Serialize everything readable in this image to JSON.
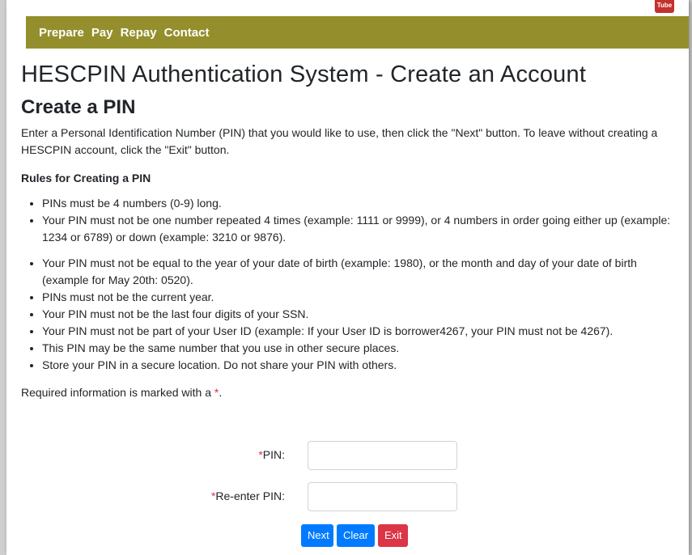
{
  "header": {
    "youtube_label": "Tube"
  },
  "nav": {
    "items": [
      "Prepare",
      "Pay",
      "Repay",
      "Contact"
    ]
  },
  "page": {
    "title": "HESCPIN Authentication System - Create an Account",
    "subtitle": "Create a PIN",
    "intro": "Enter a Personal Identification Number (PIN) that you would like to use, then click the \"Next\" button. To leave without creating a HESCPIN account, click the \"Exit\" button.",
    "rules_heading": "Rules for Creating a PIN",
    "rules": [
      "PINs must be 4 numbers (0-9) long.",
      "Your PIN must not be one number repeated 4 times (example: 1111 or 9999), or 4 numbers in order going either up (example: 1234 or 6789) or down (example: 3210 or 9876).",
      "Your PIN must not be equal to the year of your date of birth (example: 1980), or the month and day of your date of birth (example for May 20th: 0520).",
      "PINs must not be the current year.",
      "Your PIN must not be the last four digits of your SSN.",
      "Your PIN must not be part of your User ID (example: If your User ID is borrower4267, your PIN must not be 4267).",
      "This PIN may be the same number that you use in other secure places.",
      "Store your PIN in a secure location. Do not share your PIN with others."
    ],
    "required_note_prefix": "Required information is marked with a ",
    "required_marker": "*",
    "required_note_suffix": "."
  },
  "form": {
    "required_marker": "*",
    "pin_label": "PIN:",
    "pin_value": "",
    "reenter_label": "Re-enter PIN:",
    "reenter_value": ""
  },
  "buttons": {
    "next": "Next",
    "clear": "Clear",
    "exit": "Exit"
  },
  "colors": {
    "nav_background": "#948f2c",
    "primary": "#007bff",
    "danger": "#dc3545"
  }
}
